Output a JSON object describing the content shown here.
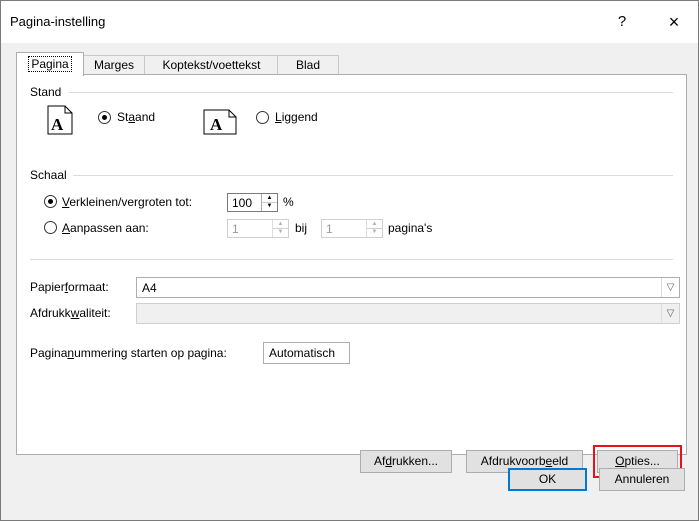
{
  "window": {
    "title": "Pagina-instelling",
    "help": "?",
    "close": "×"
  },
  "tabs": [
    {
      "label": "Pagina",
      "active": true
    },
    {
      "label": "Marges"
    },
    {
      "label": "Koptekst/voettekst"
    },
    {
      "label": "Blad"
    }
  ],
  "stand": {
    "label": "Stand",
    "portrait": {
      "pre": "St",
      "key": "a",
      "post": "and",
      "selected": true
    },
    "landscape": {
      "pre": "",
      "key": "L",
      "post": "iggend",
      "selected": false
    },
    "icon_letter": "A"
  },
  "schaal": {
    "label": "Schaal",
    "adjust": {
      "pre": "",
      "key": "V",
      "post": "erkleinen/vergroten tot:",
      "value": "100",
      "unit": "%"
    },
    "fit": {
      "pre": "",
      "key": "A",
      "post": "anpassen aan:",
      "wide": "1",
      "by": "bij",
      "tall": "1",
      "unit": "pagina's"
    }
  },
  "paper": {
    "pre": "Papier",
    "key": "f",
    "post": "ormaat:",
    "value": "A4"
  },
  "quality": {
    "pre": "Afdrukk",
    "key": "w",
    "post": "aliteit:",
    "value": ""
  },
  "first_page": {
    "pre": "Pagina",
    "key": "n",
    "post": "ummering starten op pagina:",
    "value": "Automatisch"
  },
  "buttons": {
    "print": {
      "pre": "Af",
      "key": "d",
      "post": "rukken..."
    },
    "preview": {
      "pre": "Afdrukvoorb",
      "key": "e",
      "post": "eld"
    },
    "options": {
      "pre": "",
      "key": "O",
      "post": "pties..."
    },
    "ok": "OK",
    "cancel": "Annuleren"
  },
  "highlight_color": "#e8101a"
}
